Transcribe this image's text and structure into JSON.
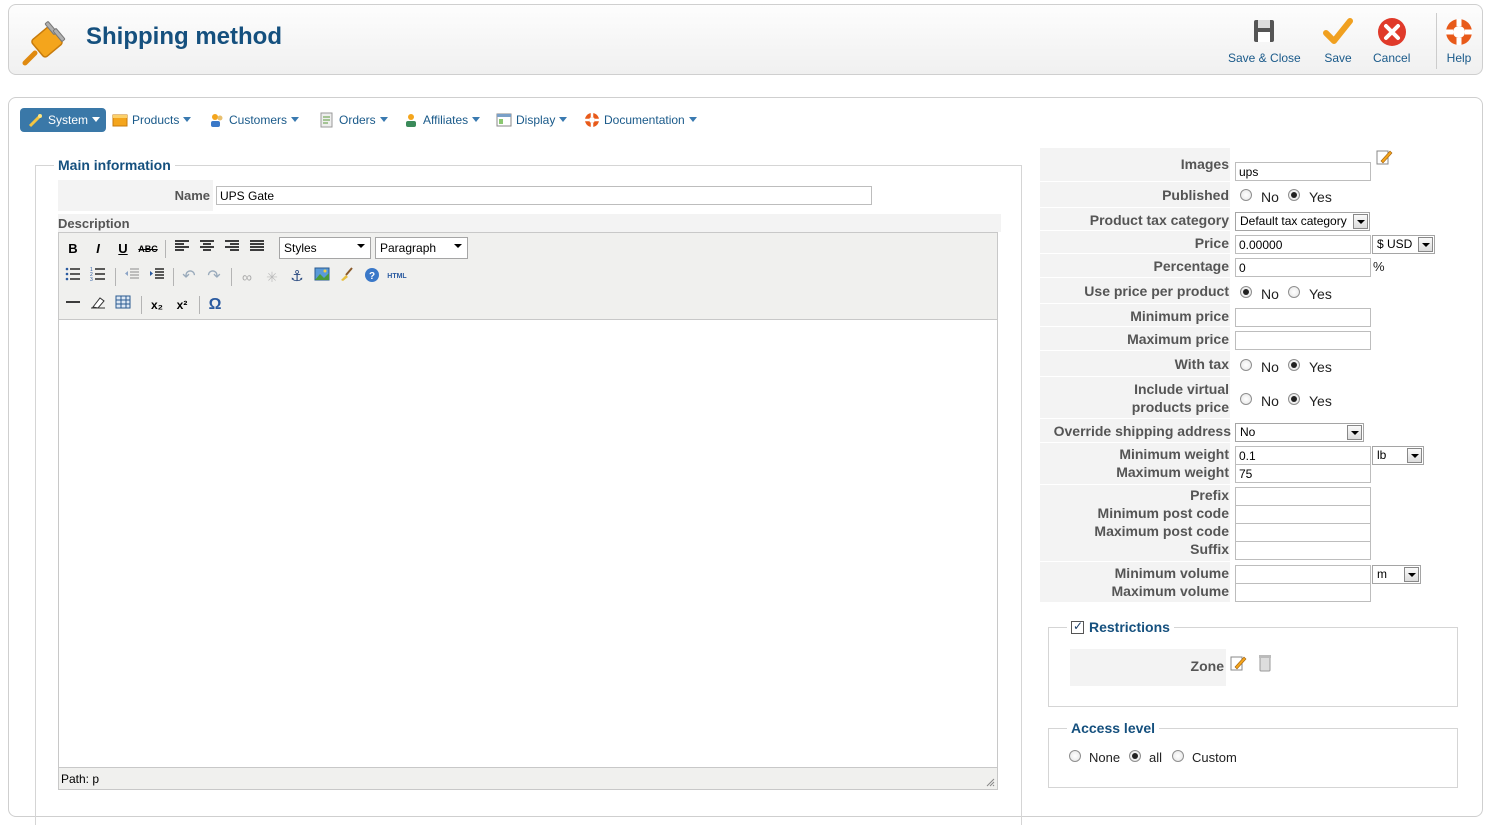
{
  "header": {
    "title": "Shipping method",
    "buttons": {
      "save_close": "Save & Close",
      "save": "Save",
      "cancel": "Cancel",
      "help": "Help"
    }
  },
  "menu": {
    "items": [
      "System",
      "Products",
      "Customers",
      "Orders",
      "Affiliates",
      "Display",
      "Documentation"
    ]
  },
  "main_info": {
    "legend": "Main information",
    "name_label": "Name",
    "name_value": "UPS Gate",
    "description_label": "Description",
    "editor": {
      "styles": "Styles",
      "format": "Paragraph",
      "status": "Path: p",
      "buttons": {
        "bold": "B",
        "italic": "I",
        "underline": "U",
        "strike": "ABC",
        "omega": "Ω",
        "html": "HTML",
        "sub": "x₂",
        "sup": "x²"
      }
    }
  },
  "settings": {
    "images_label": "Images",
    "images_value": "ups",
    "published_label": "Published",
    "no": "No",
    "yes": "Yes",
    "tax_category_label": "Product tax category",
    "tax_category_value": "Default tax category",
    "price_label": "Price",
    "price_value": "0.00000",
    "currency_value": "$ USD",
    "percentage_label": "Percentage",
    "percentage_value": "0",
    "percent_sign": "%",
    "use_price_per_product_label": "Use price per product",
    "min_price_label": "Minimum price",
    "max_price_label": "Maximum price",
    "with_tax_label": "With tax",
    "include_virtual_label_1": "Include virtual",
    "include_virtual_label_2": "products price",
    "override_shipping_label": "Override shipping address",
    "override_shipping_value": "No",
    "min_weight_label": "Minimum weight",
    "min_weight_value": "0.1",
    "weight_unit": "lb",
    "max_weight_label": "Maximum weight",
    "max_weight_value": "75",
    "prefix_label": "Prefix",
    "min_post_label": "Minimum post code",
    "max_post_label": "Maximum post code",
    "suffix_label": "Suffix",
    "min_volume_label": "Minimum volume",
    "volume_unit": "m",
    "max_volume_label": "Maximum volume"
  },
  "restrictions": {
    "legend": "Restrictions",
    "zone_label": "Zone"
  },
  "access": {
    "legend": "Access level",
    "none": "None",
    "all": "all",
    "custom": "Custom"
  },
  "colors": {
    "title": "#15507e",
    "link": "#1a5a8a",
    "menu_active": "#3a78a8"
  }
}
